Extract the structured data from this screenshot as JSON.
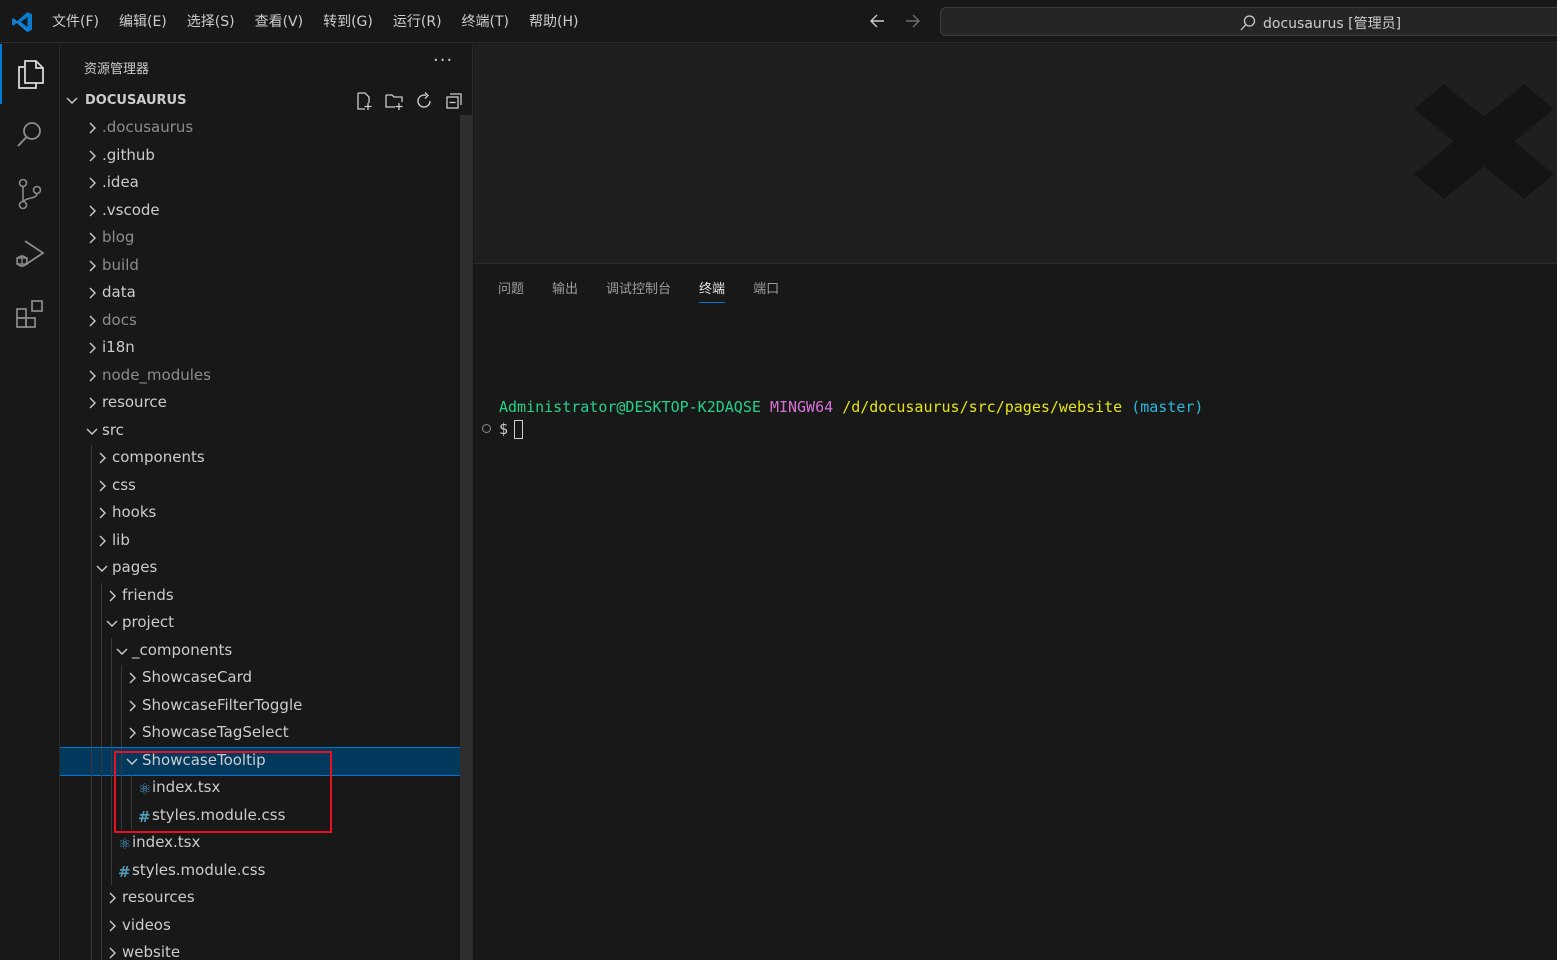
{
  "menu": [
    "文件(F)",
    "编辑(E)",
    "选择(S)",
    "查看(V)",
    "转到(G)",
    "运行(R)",
    "终端(T)",
    "帮助(H)"
  ],
  "command_center": {
    "text": "docusaurus [管理员]",
    "icon": "search-icon"
  },
  "activity_bar": [
    "explorer-icon",
    "search-icon",
    "source-control-icon",
    "run-debug-icon",
    "extensions-icon"
  ],
  "sidebar": {
    "title": "资源管理器",
    "more": "···",
    "root_label": "DOCUSAURUS",
    "root_actions": [
      "new-file-icon",
      "new-folder-icon",
      "refresh-icon",
      "collapse-all-icon"
    ]
  },
  "tree": [
    {
      "label": ".docusaurus",
      "depth": 0,
      "type": "folder",
      "expanded": false,
      "dim": true
    },
    {
      "label": ".github",
      "depth": 0,
      "type": "folder",
      "expanded": false,
      "dim": false
    },
    {
      "label": ".idea",
      "depth": 0,
      "type": "folder",
      "expanded": false,
      "dim": false
    },
    {
      "label": ".vscode",
      "depth": 0,
      "type": "folder",
      "expanded": false,
      "dim": false
    },
    {
      "label": "blog",
      "depth": 0,
      "type": "folder",
      "expanded": false,
      "dim": true
    },
    {
      "label": "build",
      "depth": 0,
      "type": "folder",
      "expanded": false,
      "dim": true
    },
    {
      "label": "data",
      "depth": 0,
      "type": "folder",
      "expanded": false,
      "dim": false
    },
    {
      "label": "docs",
      "depth": 0,
      "type": "folder",
      "expanded": false,
      "dim": true
    },
    {
      "label": "i18n",
      "depth": 0,
      "type": "folder",
      "expanded": false,
      "dim": false
    },
    {
      "label": "node_modules",
      "depth": 0,
      "type": "folder",
      "expanded": false,
      "dim": true
    },
    {
      "label": "resource",
      "depth": 0,
      "type": "folder",
      "expanded": false,
      "dim": false
    },
    {
      "label": "src",
      "depth": 0,
      "type": "folder",
      "expanded": true,
      "dim": false
    },
    {
      "label": "components",
      "depth": 1,
      "type": "folder",
      "expanded": false,
      "dim": false
    },
    {
      "label": "css",
      "depth": 1,
      "type": "folder",
      "expanded": false,
      "dim": false
    },
    {
      "label": "hooks",
      "depth": 1,
      "type": "folder",
      "expanded": false,
      "dim": false
    },
    {
      "label": "lib",
      "depth": 1,
      "type": "folder",
      "expanded": false,
      "dim": false
    },
    {
      "label": "pages",
      "depth": 1,
      "type": "folder",
      "expanded": true,
      "dim": false
    },
    {
      "label": "friends",
      "depth": 2,
      "type": "folder",
      "expanded": false,
      "dim": false
    },
    {
      "label": "project",
      "depth": 2,
      "type": "folder",
      "expanded": true,
      "dim": false
    },
    {
      "label": "_components",
      "depth": 3,
      "type": "folder",
      "expanded": true,
      "dim": false
    },
    {
      "label": "ShowcaseCard",
      "depth": 4,
      "type": "folder",
      "expanded": false,
      "dim": false
    },
    {
      "label": "ShowcaseFilterToggle",
      "depth": 4,
      "type": "folder",
      "expanded": false,
      "dim": false
    },
    {
      "label": "ShowcaseTagSelect",
      "depth": 4,
      "type": "folder",
      "expanded": false,
      "dim": false
    },
    {
      "label": "ShowcaseTooltip",
      "depth": 4,
      "type": "folder",
      "expanded": true,
      "dim": false,
      "selected": true
    },
    {
      "label": "index.tsx",
      "depth": 5,
      "type": "tsx",
      "dim": false
    },
    {
      "label": "styles.module.css",
      "depth": 5,
      "type": "css",
      "dim": false
    },
    {
      "label": "index.tsx",
      "depth": 3,
      "type": "tsx",
      "dim": false
    },
    {
      "label": "styles.module.css",
      "depth": 3,
      "type": "css",
      "dim": false
    },
    {
      "label": "resources",
      "depth": 2,
      "type": "folder",
      "expanded": false,
      "dim": false
    },
    {
      "label": "videos",
      "depth": 2,
      "type": "folder",
      "expanded": false,
      "dim": false
    },
    {
      "label": "website",
      "depth": 2,
      "type": "folder",
      "expanded": false,
      "dim": false
    }
  ],
  "panel": {
    "tabs": [
      "问题",
      "输出",
      "调试控制台",
      "终端",
      "端口"
    ],
    "active_tab": "终端"
  },
  "terminal": {
    "user": "Administrator@DESKTOP-K2DAQSE",
    "system": "MINGW64",
    "path": "/d/docusaurus/src/pages/website",
    "branch": "(master)",
    "prompt": "$"
  },
  "colors": {
    "accent": "#0078d4",
    "selection_bg": "#04395e",
    "annotation_box": "#e81123",
    "term_green": "#23d18b",
    "term_magenta": "#d670d6",
    "term_yellow": "#e5e510",
    "term_cyan": "#29b8db"
  }
}
